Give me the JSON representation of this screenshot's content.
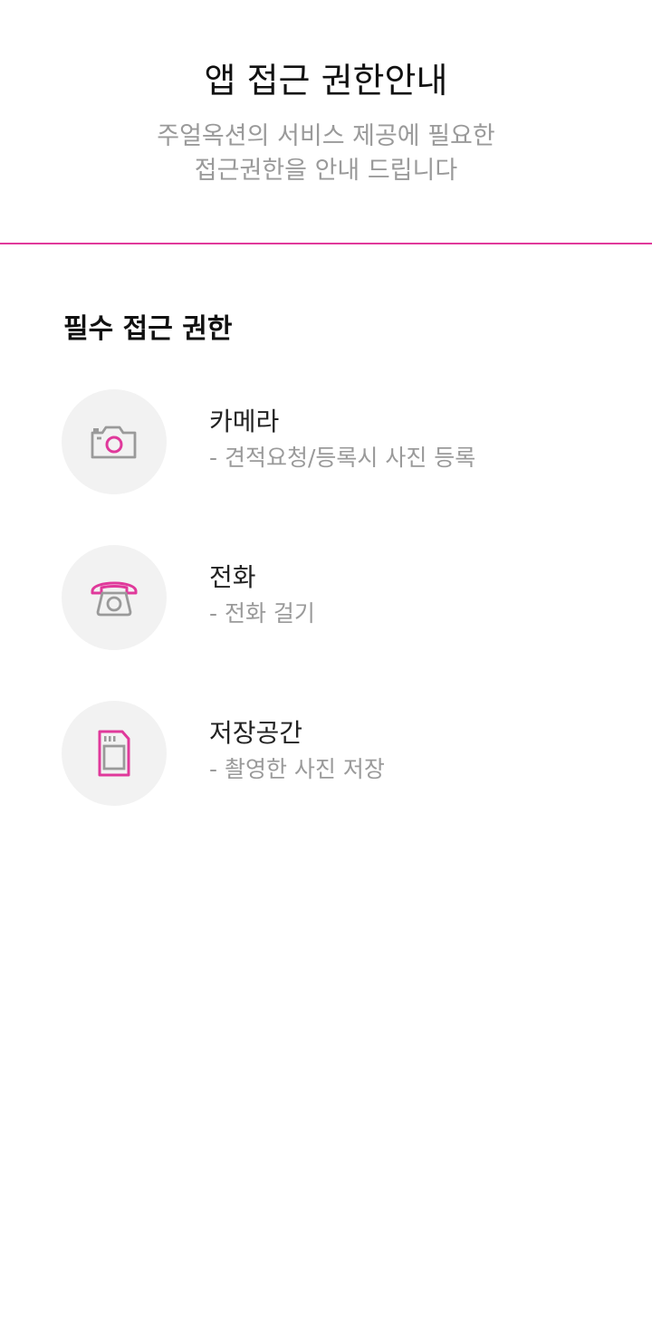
{
  "header": {
    "title": "앱 접근 권한안내",
    "subtitle_line1": "주얼옥션의 서비스 제공에 필요한",
    "subtitle_line2": "접근권한을 안내 드립니다"
  },
  "colors": {
    "accent": "#e0399b",
    "icon_gray": "#9a9a9a",
    "circle_bg": "#f2f2f2"
  },
  "section": {
    "title": "필수 접근 권한"
  },
  "permissions": [
    {
      "icon": "camera-icon",
      "name": "카메라",
      "desc": "- 견적요청/등록시 사진 등록"
    },
    {
      "icon": "telephone-icon",
      "name": "전화",
      "desc": "- 전화 걸기"
    },
    {
      "icon": "sd-card-icon",
      "name": "저장공간",
      "desc": "- 촬영한 사진 저장"
    }
  ]
}
